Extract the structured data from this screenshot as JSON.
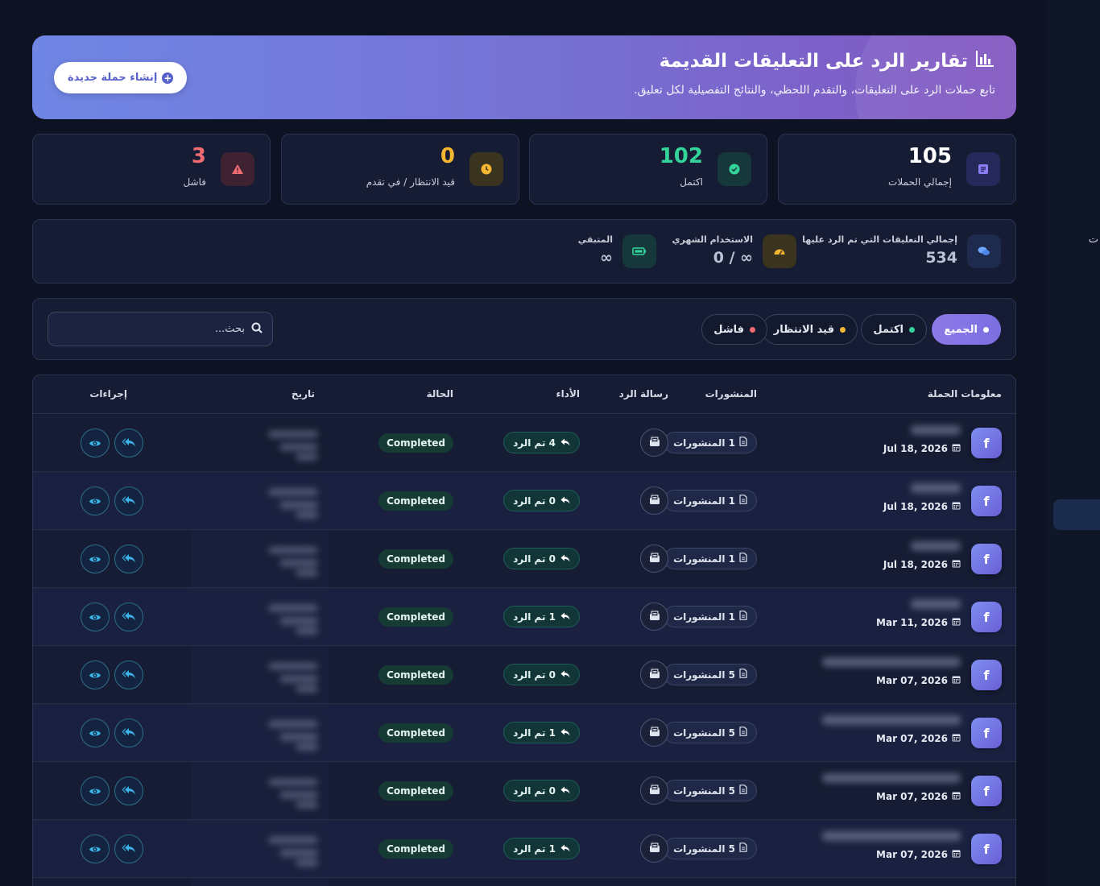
{
  "hero": {
    "title": "تقارير الرد على التعليقات القديمة",
    "subtitle": "تابع حملات الرد على التعليقات، والتقدم اللحظي، والنتائج التفصيلية لكل تعليق.",
    "new_campaign_label": "إنشاء حملة جديدة"
  },
  "stats": [
    {
      "value": "105",
      "label": "إجمالي الحملات",
      "color": "#ffffff",
      "icon": "list-icon"
    },
    {
      "value": "102",
      "label": "اكتمل",
      "color": "#34d399",
      "icon": "check-circle-icon"
    },
    {
      "value": "0",
      "label": "قيد الانتظار / في تقدم",
      "color": "#f5b731",
      "icon": "clock-icon"
    },
    {
      "value": "3",
      "label": "فاشل",
      "color": "#f16b72",
      "icon": "warning-icon"
    }
  ],
  "usage": {
    "total_label": "إجمالي التعليقات التي تم الرد عليها",
    "total_value": "534",
    "monthly_label": "الاستخدام الشهري",
    "monthly_value": "0 / ∞",
    "remaining_label": "المتبقي",
    "remaining_value": "∞"
  },
  "filters": {
    "chips": [
      {
        "label": "الجميع",
        "dot": "#ffffff",
        "active": true
      },
      {
        "label": "اكتمل",
        "dot": "#34d399",
        "active": false
      },
      {
        "label": "قيد الانتظار",
        "dot": "#f5b731",
        "active": false
      },
      {
        "label": "فاشل",
        "dot": "#f16b72",
        "active": false
      }
    ],
    "search_placeholder": "بحث..."
  },
  "table": {
    "headers": {
      "campaign": "معلومات الحملة",
      "posts": "المنشورات",
      "reply_message": "رسالة الرد",
      "performance": "الأداء",
      "status": "الحالة",
      "date": "تاريخ",
      "actions": "إجراءات"
    },
    "rows": [
      {
        "date": "Jul 18, 2026",
        "posts": "1 المنشورات",
        "performance": "4 تم الرد",
        "status": "Completed"
      },
      {
        "date": "Jul 18, 2026",
        "posts": "1 المنشورات",
        "performance": "0 تم الرد",
        "status": "Completed"
      },
      {
        "date": "Jul 18, 2026",
        "posts": "1 المنشورات",
        "performance": "0 تم الرد",
        "status": "Completed"
      },
      {
        "date": "Mar 11, 2026",
        "posts": "1 المنشورات",
        "performance": "1 تم الرد",
        "status": "Completed"
      },
      {
        "date": "Mar 07, 2026",
        "posts": "5 المنشورات",
        "performance": "0 تم الرد",
        "status": "Completed"
      },
      {
        "date": "Mar 07, 2026",
        "posts": "5 المنشورات",
        "performance": "1 تم الرد",
        "status": "Completed"
      },
      {
        "date": "Mar 07, 2026",
        "posts": "5 المنشورات",
        "performance": "0 تم الرد",
        "status": "Completed"
      },
      {
        "date": "Mar 07, 2026",
        "posts": "5 المنشورات",
        "performance": "1 تم الرد",
        "status": "Completed"
      }
    ]
  },
  "side": {
    "fragment": "ت"
  }
}
